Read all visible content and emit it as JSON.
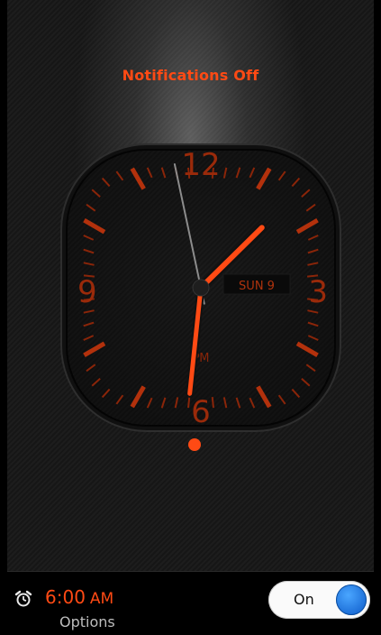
{
  "status": {
    "notifications_text": "Notifications Off"
  },
  "clock": {
    "numerals": {
      "twelve": "12",
      "three": "3",
      "six": "6",
      "nine": "9"
    },
    "date_label": "SUN 9",
    "period_label": "PM",
    "time_shown": "1:31",
    "accent_color": "#ff4a14"
  },
  "alarm": {
    "icon": "alarm-clock-icon",
    "time": "6:00",
    "ampm": "AM",
    "options_label": "Options",
    "toggle_label": "On",
    "toggle_state": true
  },
  "colors": {
    "accent": "#ff4a14",
    "toggle_knob": "#1d6fd8"
  }
}
